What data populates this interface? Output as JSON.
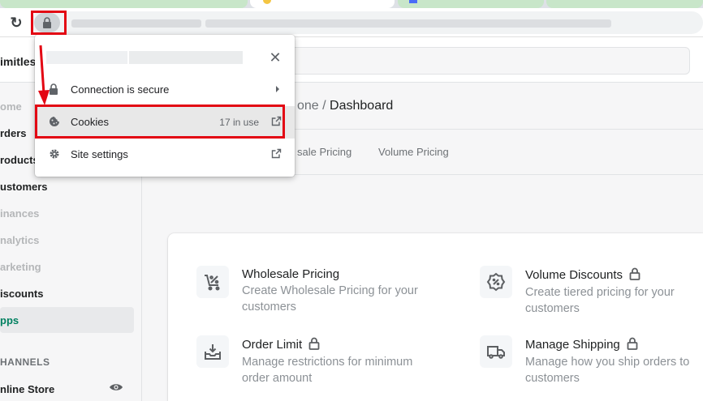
{
  "browser": {
    "reload_icon": "reload-icon",
    "lock_icon": "lock-icon",
    "address_url": ""
  },
  "store": {
    "name": "imitless"
  },
  "sidebar": {
    "items": [
      {
        "label": "ome",
        "state": "muted"
      },
      {
        "label": "rders",
        "state": "normal"
      },
      {
        "label": "roducts",
        "state": "normal"
      },
      {
        "label": "ustomers",
        "state": "normal"
      },
      {
        "label": "inances",
        "state": "muted"
      },
      {
        "label": "nalytics",
        "state": "muted"
      },
      {
        "label": "arketing",
        "state": "muted"
      },
      {
        "label": "iscounts",
        "state": "normal"
      },
      {
        "label": "pps",
        "state": "active"
      }
    ],
    "channels_label": "HANNELS",
    "channel_item": "nline Store"
  },
  "main": {
    "breadcrumb_prefix": "one",
    "breadcrumb_sep": " / ",
    "breadcrumb_current": "Dashboard",
    "tabs": [
      "sale Pricing",
      "Volume Pricing"
    ]
  },
  "features": [
    {
      "title": "Wholesale Pricing",
      "desc": "Create Wholesale Pricing for your customers",
      "locked": false,
      "icon": "cart-percent-icon"
    },
    {
      "title": "Volume Discounts",
      "desc": "Create tiered pricing for your customers",
      "locked": true,
      "icon": "discount-badge-icon"
    },
    {
      "title": "Order Limit",
      "desc": "Manage restrictions for minimum order amount",
      "locked": true,
      "icon": "inbox-download-icon"
    },
    {
      "title": "Manage Shipping",
      "desc": "Manage how you ship orders to customers",
      "locked": true,
      "icon": "truck-icon"
    }
  ],
  "popup": {
    "close_icon": "close-icon",
    "rows": [
      {
        "label": "Connection is secure",
        "extra": "",
        "icon": "lock-icon",
        "right_icon": "chevron-right-icon"
      },
      {
        "label": "Cookies",
        "extra": "17 in use",
        "icon": "cookie-icon",
        "right_icon": "external-link-icon"
      },
      {
        "label": "Site settings",
        "extra": "",
        "icon": "gear-icon",
        "right_icon": "external-link-icon"
      }
    ]
  },
  "colors": {
    "highlight": "#e30613",
    "active_nav": "#008060",
    "tab_green": "#c8e6c9"
  }
}
